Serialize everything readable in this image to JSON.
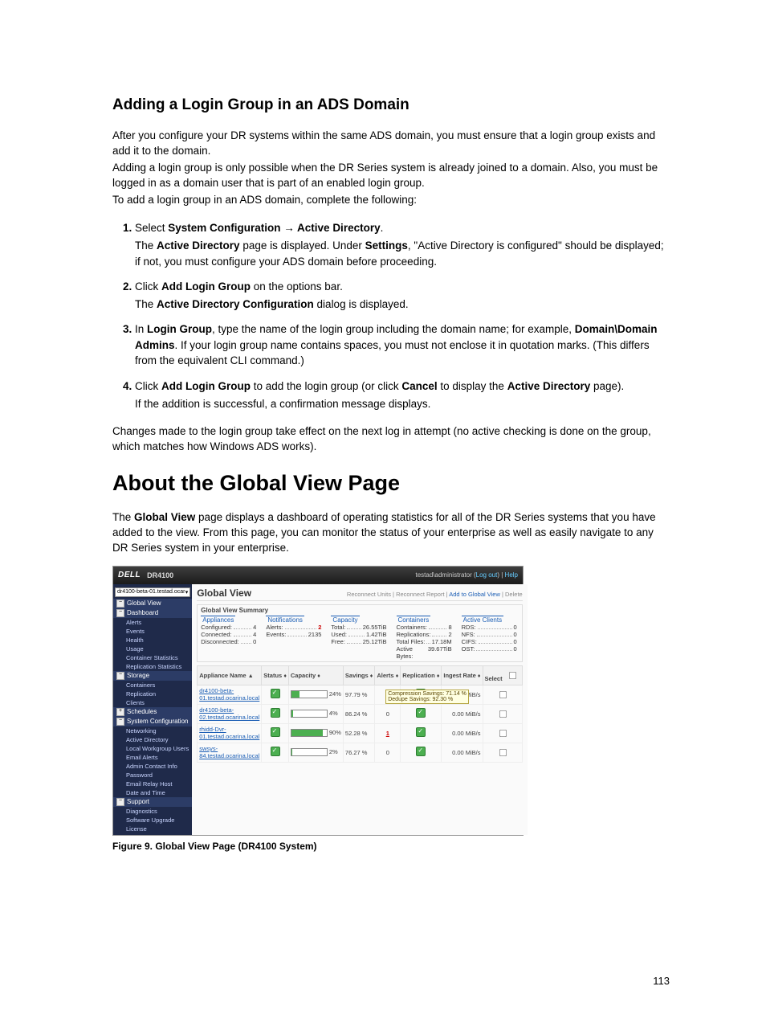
{
  "section1": {
    "title": "Adding a Login Group in an ADS Domain",
    "para1": "After you configure your DR systems within the same ADS domain, you must ensure that a login group exists and add it to the domain.",
    "para2": "Adding a login group is only possible when the DR Series system is already joined to a domain. Also, you must be logged in as a domain user that is part of an enabled login group.",
    "para3": "To add a login group in an ADS domain, complete the following:",
    "steps": [
      {
        "pre": "Select ",
        "bold1": "System Configuration → Active Directory",
        "post1": ".",
        "sub_pre": "The ",
        "sub_b1": "Active Directory",
        "sub_mid1": " page is displayed. Under ",
        "sub_b2": "Settings",
        "sub_post": ", \"Active Directory is configured\" should be displayed; if not, you must configure your ADS domain before proceeding."
      },
      {
        "pre": "Click ",
        "bold1": "Add Login Group",
        "post1": " on the options bar.",
        "sub_pre": "The ",
        "sub_b1": "Active Directory Configuration",
        "sub_post": " dialog is displayed."
      },
      {
        "pre": "In ",
        "bold1": "Login Group",
        "post1": ", type the name of the login group including the domain name; for example, ",
        "bold2": "Domain\\Domain Admins",
        "post2": ". If your login group name contains spaces, you must not enclose it in quotation marks. (This differs from the equivalent CLI command.)"
      },
      {
        "pre": "Click ",
        "bold1": "Add Login Group",
        "post1": " to add the login group (or click ",
        "bold2": "Cancel",
        "post2": " to display the ",
        "bold3": "Active Directory",
        "post3": " page).",
        "sub_plain": "If the addition is successful, a confirmation message displays."
      }
    ],
    "after": "Changes made to the login group take effect on the next log in attempt (no active checking is done on the group, which matches how Windows ADS works)."
  },
  "section2": {
    "title": "About the Global View Page",
    "para_pre": "The ",
    "para_b": "Global View",
    "para_post": " page displays a dashboard of operating statistics for all of the DR Series systems that you have added to the view. From this page, you can monitor the status of your enterprise as well as easily navigate to any DR Series system in your enterprise."
  },
  "figure_caption": "Figure 9. Global View Page (DR4100 System)",
  "page_number": "113",
  "ss": {
    "logo": "DELL",
    "model": "DR4100",
    "user_label": "testad\\administrator",
    "logout": "Log out",
    "help": "Help",
    "host_selector": "dr4100-beta-01.testad.ocar",
    "nav": {
      "global_view": "Global View",
      "dashboard": "Dashboard",
      "alerts": "Alerts",
      "events": "Events",
      "health": "Health",
      "usage": "Usage",
      "container_stats": "Container Statistics",
      "replication_stats": "Replication Statistics",
      "storage": "Storage",
      "containers": "Containers",
      "replication": "Replication",
      "clients": "Clients",
      "schedules": "Schedules",
      "sys_config": "System Configuration",
      "networking": "Networking",
      "active_directory": "Active Directory",
      "local_wg_users": "Local Workgroup Users",
      "email_alerts": "Email Alerts",
      "admin_contact": "Admin Contact Info",
      "password": "Password",
      "email_relay": "Email Relay Host",
      "date_time": "Date and Time",
      "support": "Support",
      "diagnostics": "Diagnostics",
      "software_upgrade": "Software Upgrade",
      "license": "License"
    },
    "main": {
      "title": "Global View",
      "actions": {
        "reconnect_units": "Reconnect Units",
        "reconnect_report": "Reconnect Report",
        "add_to_gv": "Add to Global View",
        "delete": "Delete"
      },
      "summary_title": "Global View Summary",
      "cols": {
        "appliances": {
          "h": "Appliances",
          "configured_k": "Configured:",
          "configured_v": "4",
          "connected_k": "Connected:",
          "connected_v": "4",
          "disconnected_k": "Disconnected:",
          "disconnected_v": "0"
        },
        "notifications": {
          "h": "Notifications",
          "alerts_k": "Alerts:",
          "alerts_v": "2",
          "events_k": "Events:",
          "events_v": "2135"
        },
        "capacity": {
          "h": "Capacity",
          "total_k": "Total:",
          "total_v": "26.55TiB",
          "used_k": "Used:",
          "used_v": "1.42TiB",
          "free_k": "Free:",
          "free_v": "25.12TiB"
        },
        "containers": {
          "h": "Containers",
          "cont_k": "Containers:",
          "cont_v": "8",
          "repl_k": "Replications:",
          "repl_v": "2",
          "files_k": "Total Files:",
          "files_v": "17.18M",
          "bytes_k": "Active Bytes:",
          "bytes_v": "39.67TiB"
        },
        "clients": {
          "h": "Active Clients",
          "rds_k": "RDS:",
          "rds_v": "0",
          "nfs_k": "NFS:",
          "nfs_v": "0",
          "cifs_k": "CIFS:",
          "cifs_v": "0",
          "ost_k": "OST:",
          "ost_v": "0"
        }
      },
      "table": {
        "headers": {
          "name": "Appliance Name",
          "status": "Status",
          "capacity": "Capacity",
          "savings": "Savings",
          "alerts": "Alerts",
          "replication": "Replication",
          "ingest": "Ingest Rate",
          "select": "Select"
        },
        "tooltip": {
          "line1": "Compression Savings: 71.14 %",
          "line2": "Dedupe Savings: 92.30 %"
        },
        "rows": [
          {
            "name_l1": "dr4100-beta-",
            "name_l2": "01.testad.ocarina.local",
            "cap_pct": 24,
            "cap_label": "24%",
            "savings": "97.79 %",
            "alerts": "1",
            "alerts_warn": true,
            "ingest": "0.00 MiB/s"
          },
          {
            "name_l1": "dr4100-beta-",
            "name_l2": "02.testad.ocarina.local",
            "cap_pct": 4,
            "cap_label": "4%",
            "savings": "86.24 %",
            "alerts": "0",
            "alerts_warn": false,
            "ingest": "0.00 MiB/s"
          },
          {
            "name_l1": "rhidd-Dvr-",
            "name_l2": "01.testad.ocarina.local",
            "cap_pct": 90,
            "cap_label": "90%",
            "savings": "52.28 %",
            "alerts": "1",
            "alerts_warn": true,
            "ingest": "0.00 MiB/s"
          },
          {
            "name_l1": "swsys-",
            "name_l2": "84.testad.ocarina.local",
            "cap_pct": 2,
            "cap_label": "2%",
            "savings": "76.27 %",
            "alerts": "0",
            "alerts_warn": false,
            "ingest": "0.00 MiB/s"
          }
        ]
      }
    }
  }
}
